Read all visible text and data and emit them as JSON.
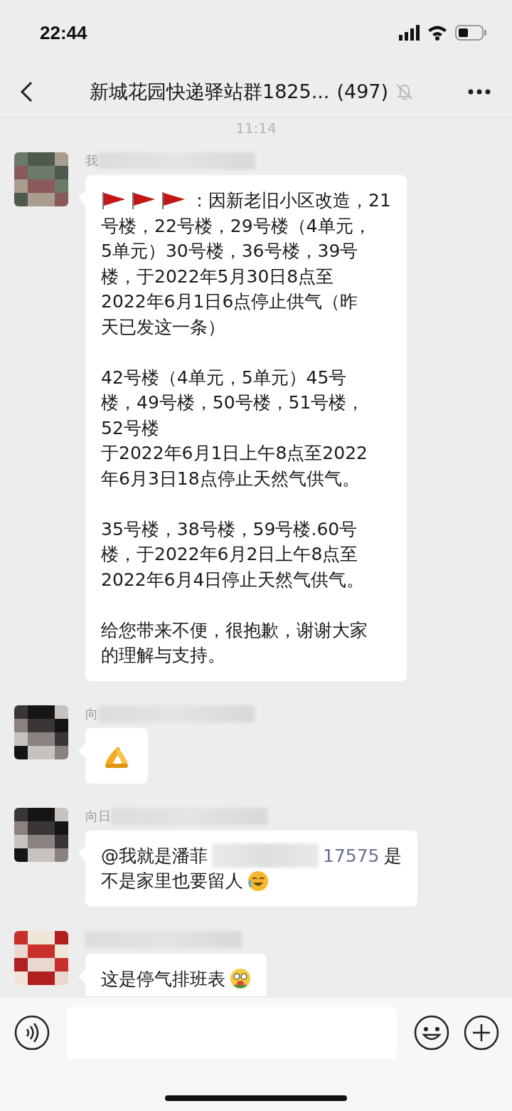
{
  "status_bar": {
    "time": "22:44"
  },
  "header": {
    "title": "新城花园快递驿站群1825...",
    "member_count": "(497)",
    "muted": true
  },
  "chat": {
    "timestamp": "11:14",
    "messages": [
      {
        "kind": "announcement",
        "sender": "我",
        "paragraphs": [
          [
            "：因新老旧小区改造，21",
            "号楼，22号楼，29号楼（4单元，",
            "5单元）30号楼，36号楼，39号",
            "楼，于2022年5月30日8点至",
            "2022年6月1日6点停止供气（昨",
            "天已发这一条）"
          ],
          [
            "42号楼（4单元，5单元）45号",
            "楼，49号楼，50号楼，51号楼，",
            "52号楼",
            "于2022年6月1日上午8点至2022",
            "年6月3日18点停止天然气供气。"
          ],
          [
            "35号楼，38号楼，59号楼.60号",
            "楼，于2022年6月2日上午8点至",
            "2022年6月4日停止天然气供气。"
          ],
          [
            "给您带来不便，很抱歉，谢谢大家",
            "的理解与支持。"
          ]
        ]
      },
      {
        "kind": "sticker",
        "sender": "向"
      },
      {
        "kind": "mention",
        "sender": "向日",
        "mention": "@我就是潘菲",
        "handle_tail": "17575",
        "lines": [
          "是",
          "不是家里也要留人"
        ]
      },
      {
        "kind": "text_emoji",
        "lines": [
          "这是停气排班表"
        ]
      }
    ]
  }
}
